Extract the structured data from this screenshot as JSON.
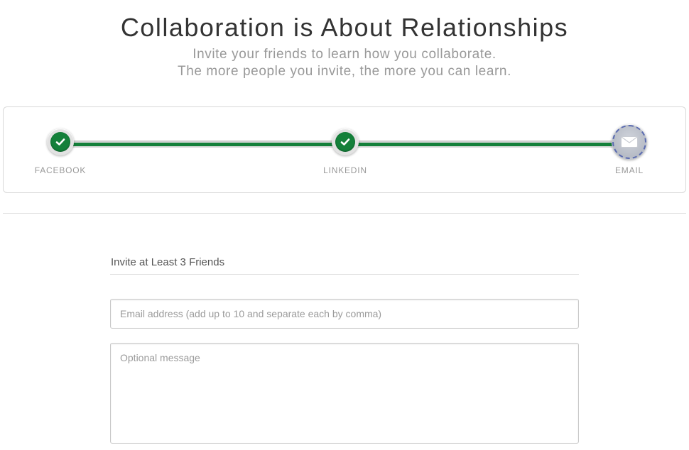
{
  "header": {
    "title": "Collaboration is About Relationships",
    "subtitle_line1": "Invite your friends to learn how you collaborate.",
    "subtitle_line2": "The more people you invite, the more you can learn."
  },
  "progress": {
    "steps": [
      {
        "label": "FACEBOOK",
        "status": "complete",
        "icon": "check-icon"
      },
      {
        "label": "LINKEDIN",
        "status": "complete",
        "icon": "check-icon"
      },
      {
        "label": "EMAIL",
        "status": "current",
        "icon": "envelope-icon"
      }
    ],
    "completion": 1.0,
    "colors": {
      "complete": "#14803a",
      "track": "#dcdcdc"
    }
  },
  "form": {
    "heading": "Invite at Least 3 Friends",
    "email_placeholder": "Email address (add up to 10 and separate each by comma)",
    "email_value": "",
    "message_placeholder": "Optional message",
    "message_value": ""
  }
}
